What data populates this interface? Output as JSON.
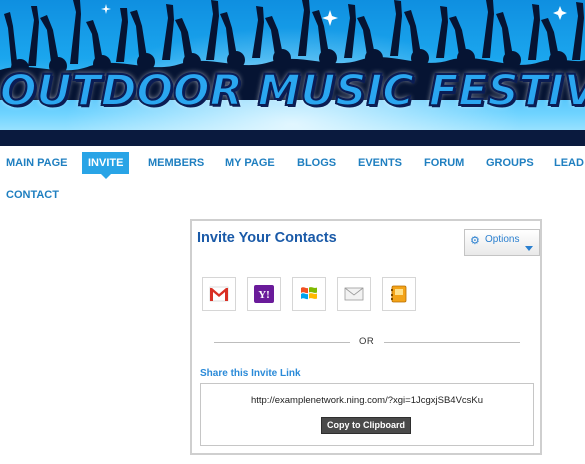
{
  "banner": {
    "title": "OUTDOOR MUSIC FESTIVALS"
  },
  "nav": {
    "items": [
      {
        "label": "MAIN PAGE",
        "active": false
      },
      {
        "label": "INVITE",
        "active": true
      },
      {
        "label": "MEMBERS",
        "active": false
      },
      {
        "label": "MY PAGE",
        "active": false
      },
      {
        "label": "BLOGS",
        "active": false
      },
      {
        "label": "EVENTS",
        "active": false
      },
      {
        "label": "FORUM",
        "active": false
      },
      {
        "label": "GROUPS",
        "active": false
      },
      {
        "label": "LEAD",
        "active": false
      },
      {
        "label": "CONTACT",
        "active": false
      }
    ]
  },
  "invite": {
    "title": "Invite Your Contacts",
    "options_label": "Options",
    "providers": [
      {
        "name": "gmail-icon"
      },
      {
        "name": "yahoo-icon"
      },
      {
        "name": "windows-live-icon"
      },
      {
        "name": "email-icon"
      },
      {
        "name": "address-book-icon"
      }
    ],
    "or_text": "OR",
    "share_label": "Share this Invite Link",
    "link_url": "http://examplenetwork.ning.com/?xgi=1JcgxjSB4VcsKu",
    "copy_button": "Copy to Clipboard"
  },
  "colors": {
    "nav_text": "#1f7fc0",
    "nav_active_bg": "#29a4e6",
    "panel_title": "#1a5aa8",
    "share_label": "#2a8ad8"
  }
}
